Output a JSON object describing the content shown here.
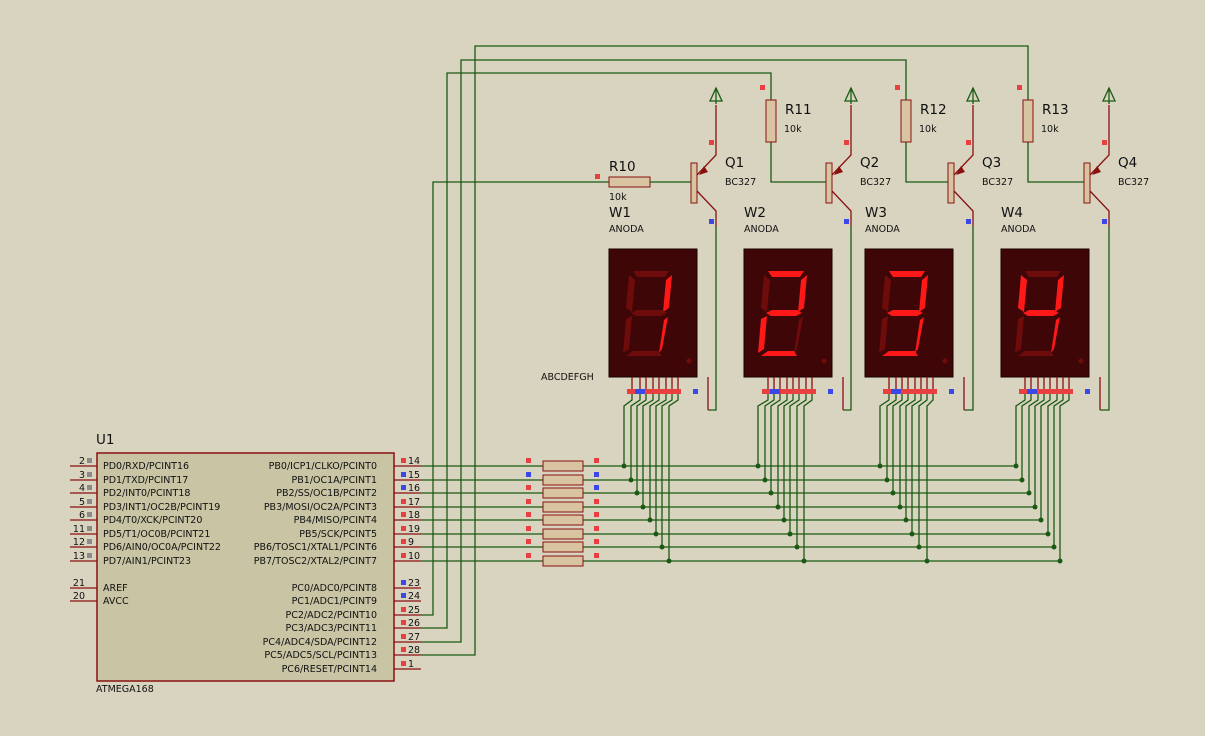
{
  "mcu": {
    "ref": "U1",
    "part": "ATMEGA168",
    "left_pins": [
      {
        "num": "2",
        "label": "PD0/RXD/PCINT16"
      },
      {
        "num": "3",
        "label": "PD1/TXD/PCINT17"
      },
      {
        "num": "4",
        "label": "PD2/INT0/PCINT18"
      },
      {
        "num": "5",
        "label": "PD3/INT1/OC2B/PCINT19"
      },
      {
        "num": "6",
        "label": "PD4/T0/XCK/PCINT20"
      },
      {
        "num": "11",
        "label": "PD5/T1/OC0B/PCINT21"
      },
      {
        "num": "12",
        "label": "PD6/AIN0/OC0A/PCINT22"
      },
      {
        "num": "13",
        "label": "PD7/AIN1/PCINT23"
      },
      {
        "num": "21",
        "label": "AREF"
      },
      {
        "num": "20",
        "label": "AVCC"
      }
    ],
    "right_pins": [
      {
        "num": "14",
        "label": "PB0/ICP1/CLKO/PCINT0"
      },
      {
        "num": "15",
        "label": "PB1/OC1A/PCINT1"
      },
      {
        "num": "16",
        "label": "PB2/SS/OC1B/PCINT2"
      },
      {
        "num": "17",
        "label": "PB3/MOSI/OC2A/PCINT3"
      },
      {
        "num": "18",
        "label": "PB4/MISO/PCINT4"
      },
      {
        "num": "19",
        "label": "PB5/SCK/PCINT5"
      },
      {
        "num": "9",
        "label": "PB6/TOSC1/XTAL1/PCINT6"
      },
      {
        "num": "10",
        "label": "PB7/TOSC2/XTAL2/PCINT7"
      },
      {
        "num": "23",
        "label": "PC0/ADC0/PCINT8"
      },
      {
        "num": "24",
        "label": "PC1/ADC1/PCINT9"
      },
      {
        "num": "25",
        "label": "PC2/ADC2/PCINT10"
      },
      {
        "num": "26",
        "label": "PC3/ADC3/PCINT11"
      },
      {
        "num": "27",
        "label": "PC4/ADC4/SDA/PCINT12"
      },
      {
        "num": "28",
        "label": "PC5/ADC5/SCL/PCINT13"
      },
      {
        "num": "1",
        "label": "PC6/RESET/PCINT14"
      }
    ]
  },
  "resistors": [
    {
      "ref": "R10",
      "value": "10k"
    },
    {
      "ref": "R11",
      "value": "10k"
    },
    {
      "ref": "R12",
      "value": "10k"
    },
    {
      "ref": "R13",
      "value": "10k"
    }
  ],
  "transistors": [
    {
      "ref": "Q1",
      "part": "BC327"
    },
    {
      "ref": "Q2",
      "part": "BC327"
    },
    {
      "ref": "Q3",
      "part": "BC327"
    },
    {
      "ref": "Q4",
      "part": "BC327"
    }
  ],
  "displays": [
    {
      "ref": "W1",
      "type": "ANODA",
      "digit": "1"
    },
    {
      "ref": "W2",
      "type": "ANODA",
      "digit": "2"
    },
    {
      "ref": "W3",
      "type": "ANODA",
      "digit": "3"
    },
    {
      "ref": "W4",
      "type": "ANODA",
      "digit": "4"
    }
  ],
  "segment_bus_label": "ABCDEFGH",
  "colors": {
    "background": "#d8d4c0",
    "wire": "#1a5a12",
    "component_outline": "#8a1010",
    "chip_fill": "#c8c4a4",
    "resistor_fill": "#d8c4a0",
    "display_body": "#3e0606",
    "segment_on": "#ff1818",
    "segment_off": "#6e0c0c",
    "pin_high": "#e84040",
    "pin_low": "#3a48e8"
  }
}
